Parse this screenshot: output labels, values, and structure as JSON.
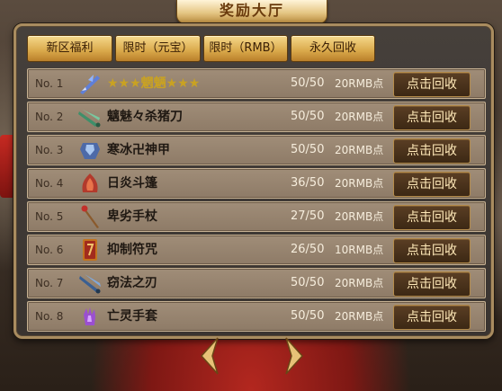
{
  "header": {
    "title": "奖励大厅"
  },
  "tabs": [
    {
      "label": "新区福利"
    },
    {
      "label": "限时（元宝）"
    },
    {
      "label": "限时（RMB）"
    },
    {
      "label": "永久回收"
    }
  ],
  "rows": [
    {
      "no": "No. 1",
      "name": "★★★魍魉★★★",
      "icon": "winged-blade-icon",
      "progress": "50/50",
      "reward": "20RMB点",
      "button": "点击回收"
    },
    {
      "no": "No. 2",
      "name": "魑魅々杀猪刀",
      "icon": "green-sword-icon",
      "progress": "50/50",
      "reward": "20RMB点",
      "button": "点击回收"
    },
    {
      "no": "No. 3",
      "name": "寒冰卍神甲",
      "icon": "ice-armor-icon",
      "progress": "50/50",
      "reward": "20RMB点",
      "button": "点击回收"
    },
    {
      "no": "No. 4",
      "name": "日炎斗篷",
      "icon": "flame-cloak-icon",
      "progress": "36/50",
      "reward": "20RMB点",
      "button": "点击回收"
    },
    {
      "no": "No. 5",
      "name": "卑劣手杖",
      "icon": "staff-icon",
      "progress": "27/50",
      "reward": "20RMB点",
      "button": "点击回收"
    },
    {
      "no": "No. 6",
      "name": "抑制符咒",
      "icon": "talisman-icon",
      "progress": "26/50",
      "reward": "10RMB点",
      "button": "点击回收"
    },
    {
      "no": "No. 7",
      "name": "窃法之刃",
      "icon": "blue-blade-icon",
      "progress": "50/50",
      "reward": "20RMB点",
      "button": "点击回收"
    },
    {
      "no": "No. 8",
      "name": "亡灵手套",
      "icon": "purple-glove-icon",
      "progress": "50/50",
      "reward": "20RMB点",
      "button": "点击回收"
    }
  ],
  "colors": {
    "tab_gold": "#e1b458",
    "row_bg": "#978470",
    "button_dark": "#4a321c",
    "carpet_red": "#9e1f19"
  }
}
